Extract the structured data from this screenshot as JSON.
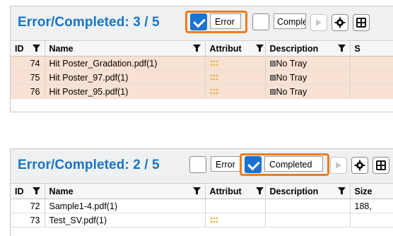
{
  "panel1": {
    "title": "Error/Completed: 3 / 5",
    "error_filter": {
      "label": "Error",
      "checked": true
    },
    "completed_filter": {
      "label": "Comple",
      "checked": false
    },
    "columns": {
      "id": "ID",
      "name": "Name",
      "attribute": "Attribut",
      "description": "Description",
      "size": "S"
    },
    "rows": [
      {
        "id": "74",
        "name": "Hit Poster_Gradation.pdf(1)",
        "description": "No Tray"
      },
      {
        "id": "75",
        "name": "Hit Poster_97.pdf(1)",
        "description": "No Tray"
      },
      {
        "id": "76",
        "name": "Hit Poster_95.pdf(1)",
        "description": "No Tray"
      }
    ]
  },
  "panel2": {
    "title": "Error/Completed: 2 / 5",
    "error_filter": {
      "label": "Error",
      "checked": false
    },
    "completed_filter": {
      "label": "Completed",
      "checked": true
    },
    "columns": {
      "id": "ID",
      "name": "Name",
      "attribute": "Attribut",
      "description": "Description",
      "size": "Size"
    },
    "rows": [
      {
        "id": "72",
        "name": "Sample1-4.pdf(1)",
        "description": "",
        "size": "188,"
      },
      {
        "id": "73",
        "name": "Test_SV.pdf(1)",
        "description": "",
        "size": ""
      }
    ]
  },
  "colors": {
    "title": "#1a75c2",
    "highlight": "#ef7d1f",
    "check": "#1a73d1",
    "error_row": "#f9e1d3"
  },
  "icons": [
    "funnel-icon",
    "settings-icon",
    "columns-icon",
    "play-icon",
    "attribute-dots-icon",
    "tray-icon"
  ]
}
